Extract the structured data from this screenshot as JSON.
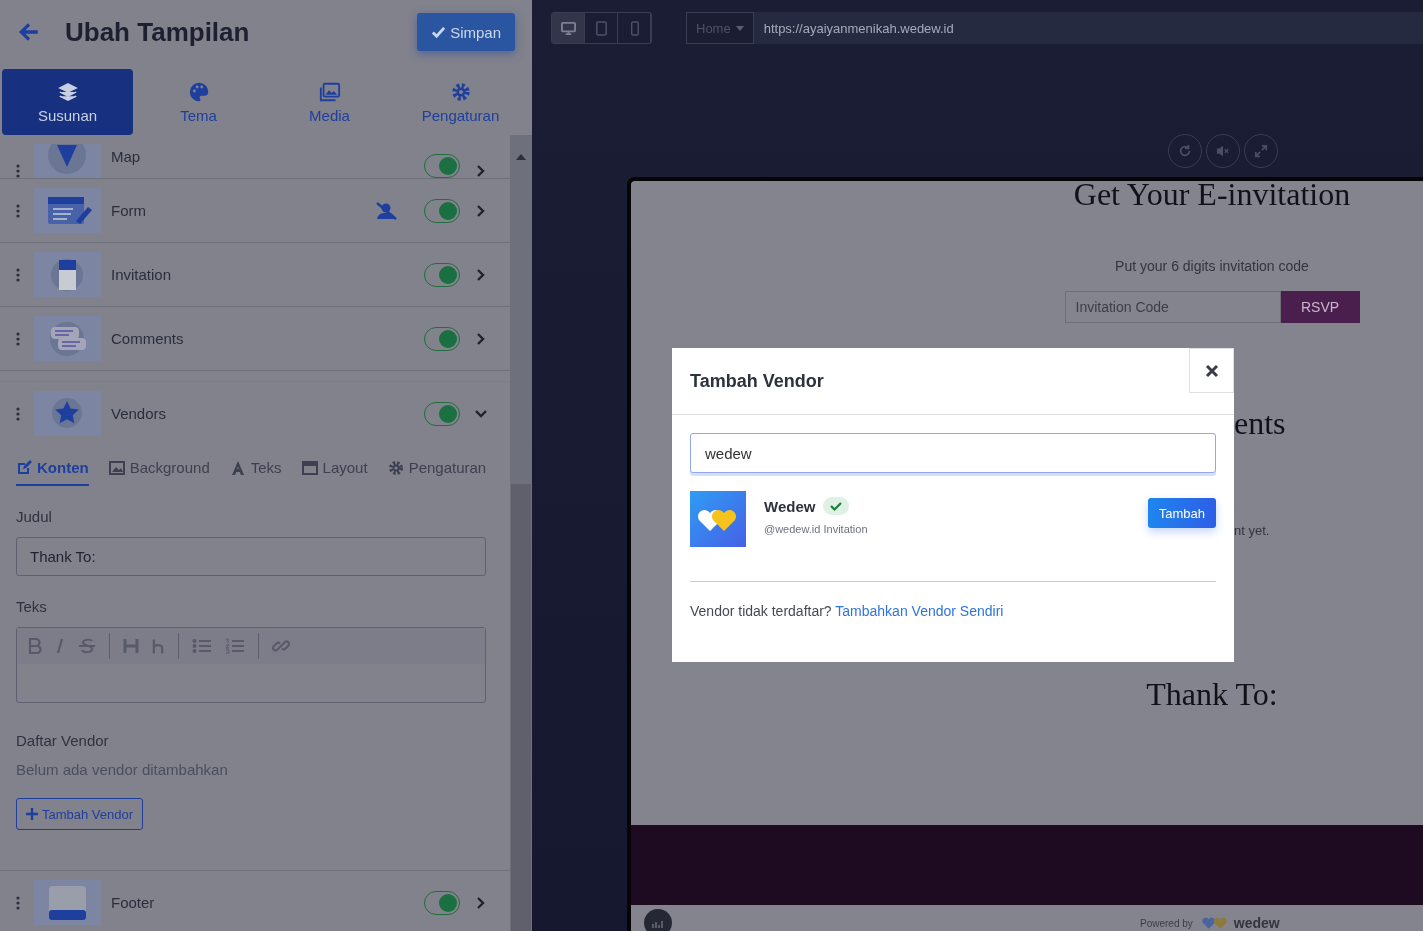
{
  "editor": {
    "title": "Ubah Tampilan",
    "save_button": "Simpan"
  },
  "main_tabs": [
    {
      "label": "Susunan",
      "selected": true
    },
    {
      "label": "Tema",
      "selected": false
    },
    {
      "label": "Media",
      "selected": false
    },
    {
      "label": "Pengaturan",
      "selected": false
    }
  ],
  "sections": [
    {
      "name": "Map",
      "enabled": true,
      "expanded": false,
      "restricted": false
    },
    {
      "name": "Form",
      "enabled": true,
      "expanded": false,
      "restricted": true
    },
    {
      "name": "Invitation",
      "enabled": true,
      "expanded": false,
      "restricted": false
    },
    {
      "name": "Comments",
      "enabled": true,
      "expanded": false,
      "restricted": false
    },
    {
      "name": "Vendors",
      "enabled": true,
      "expanded": true,
      "restricted": false
    },
    {
      "name": "Footer",
      "enabled": true,
      "expanded": false,
      "restricted": false
    }
  ],
  "vendor_settings": {
    "tabs": [
      {
        "label": "Konten",
        "selected": true
      },
      {
        "label": "Background",
        "selected": false
      },
      {
        "label": "Teks",
        "selected": false
      },
      {
        "label": "Layout",
        "selected": false
      },
      {
        "label": "Pengaturan",
        "selected": false
      }
    ],
    "title_label": "Judul",
    "title_value": "Thank To:",
    "text_label": "Teks",
    "list_label": "Daftar Vendor",
    "empty_text": "Belum ada vendor ditambahkan",
    "add_button": "Tambah Vendor"
  },
  "preview": {
    "device_modes": [
      {
        "selected": true
      },
      {
        "selected": false
      },
      {
        "selected": false
      }
    ],
    "page_dropdown": "Home",
    "url": "https://ayaiyanmenikah.wedew.id",
    "heading": "Get Your E-invitation",
    "prompt": "Put your 6 digits invitation code",
    "code_placeholder": "Invitation Code",
    "rsvp_button": "RSVP",
    "partial_heading": "ents",
    "partial_text": "nt yet.",
    "vendors_heading": "Thank To:",
    "powered_by": "Powered by",
    "brand": "wedew"
  },
  "modal": {
    "title": "Tambah Vendor",
    "search_value": "wedew",
    "results": [
      {
        "name": "Wedew",
        "verified": true,
        "handle": "@wedew.id Invitation",
        "button": "Tambah"
      }
    ],
    "footer_text": "Vendor tidak terdaftar?",
    "footer_link": "Tambahkan Vendor Sendiri"
  }
}
